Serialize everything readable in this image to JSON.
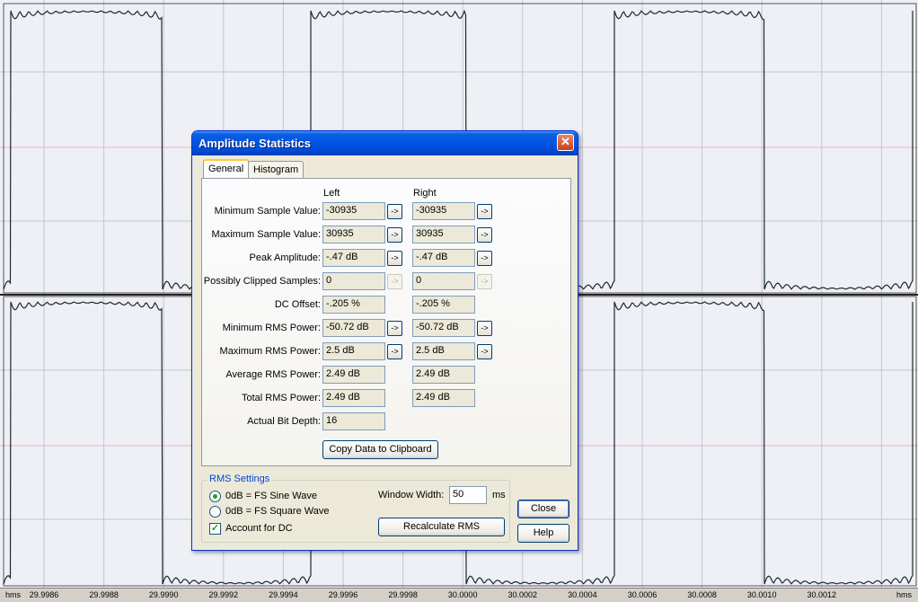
{
  "ruler": {
    "labels": [
      "29.9986",
      "29.9988",
      "29.9990",
      "29.9992",
      "29.9994",
      "29.9996",
      "29.9998",
      "30.0000",
      "30.0002",
      "30.0004",
      "30.0006",
      "30.0008",
      "30.0010",
      "30.0012"
    ],
    "unit_left": "hms",
    "unit_right": "hms"
  },
  "dialog": {
    "title": "Amplitude Statistics",
    "tabs": [
      "General",
      "Histogram"
    ],
    "col_left": "Left",
    "col_right": "Right",
    "rows": [
      {
        "label": "Minimum Sample Value:",
        "left": "-30935",
        "right": "-30935",
        "arrow": "->"
      },
      {
        "label": "Maximum Sample Value:",
        "left": "30935",
        "right": "30935",
        "arrow": "->"
      },
      {
        "label": "Peak Amplitude:",
        "left": "-.47 dB",
        "right": "-.47 dB",
        "arrow": "->"
      },
      {
        "label": "Possibly Clipped Samples:",
        "left": "0",
        "right": "0",
        "arrow": "->"
      },
      {
        "label": "DC Offset:",
        "left": "-.205 %",
        "right": "-.205 %"
      },
      {
        "label": "Minimum RMS Power:",
        "left": "-50.72 dB",
        "right": "-50.72 dB",
        "arrow": "->"
      },
      {
        "label": "Maximum RMS Power:",
        "left": "2.5 dB",
        "right": "2.5 dB",
        "arrow": "->"
      },
      {
        "label": "Average RMS Power:",
        "left": "2.49 dB",
        "right": "2.49 dB"
      },
      {
        "label": "Total RMS Power:",
        "left": "2.49 dB",
        "right": "2.49 dB"
      },
      {
        "label": "Actual Bit Depth:",
        "left": "16"
      }
    ],
    "copy_button": "Copy Data to Clipboard",
    "rms_settings": {
      "legend": "RMS Settings",
      "option_sine": "0dB = FS Sine Wave",
      "option_square": "0dB = FS Square Wave",
      "account_dc": "Account for DC",
      "window_label": "Window Width:",
      "window_value": "50",
      "window_unit": "ms",
      "recalc_button": "Recalculate RMS"
    },
    "close_button": "Close",
    "help_button": "Help"
  }
}
